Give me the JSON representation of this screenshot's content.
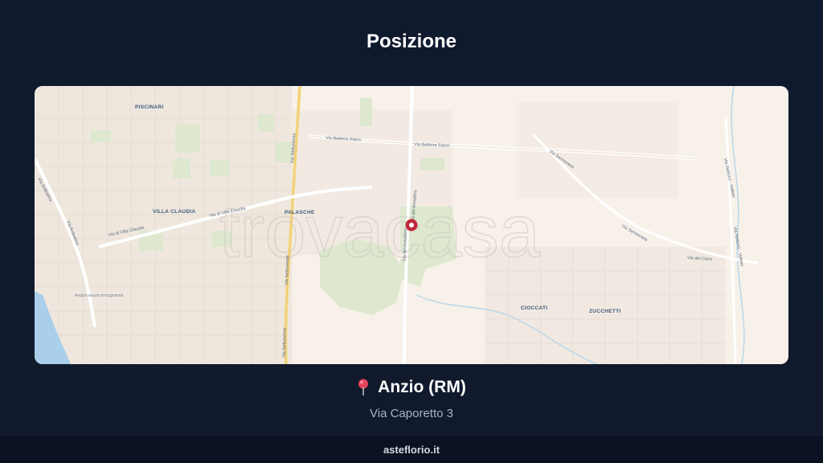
{
  "page": {
    "title": "Posizione"
  },
  "map": {
    "watermark": "trovacasa",
    "districts": [
      "PISCINARI",
      "VILLA CLAUDIA",
      "PALASCHE",
      "CIOCCATI",
      "ZUCCHETTI",
      "PIAZZA SALVO D'ACQUISTO"
    ],
    "roads": [
      "Via Batteria Siacci",
      "Via Batteria Siacci",
      "Via Nettunense",
      "Via Nettunense",
      "Via Nettunense",
      "Via di Villa Claudia",
      "Via di Villa Claudia",
      "Via Ardeatina",
      "Via Ardeatina",
      "Via Sermoneta",
      "Via Sermoneta",
      "Via dei Cerci",
      "Via Nettuno - Velletri",
      "Via Nettuno - Velletri",
      "Via del Armellino",
      "Via del Armellino"
    ],
    "marker_color": "#c0283c"
  },
  "location": {
    "city": "Anzio (RM)",
    "address": "Via Caporetto 3"
  },
  "footer": {
    "site": "asteflorio.it"
  }
}
